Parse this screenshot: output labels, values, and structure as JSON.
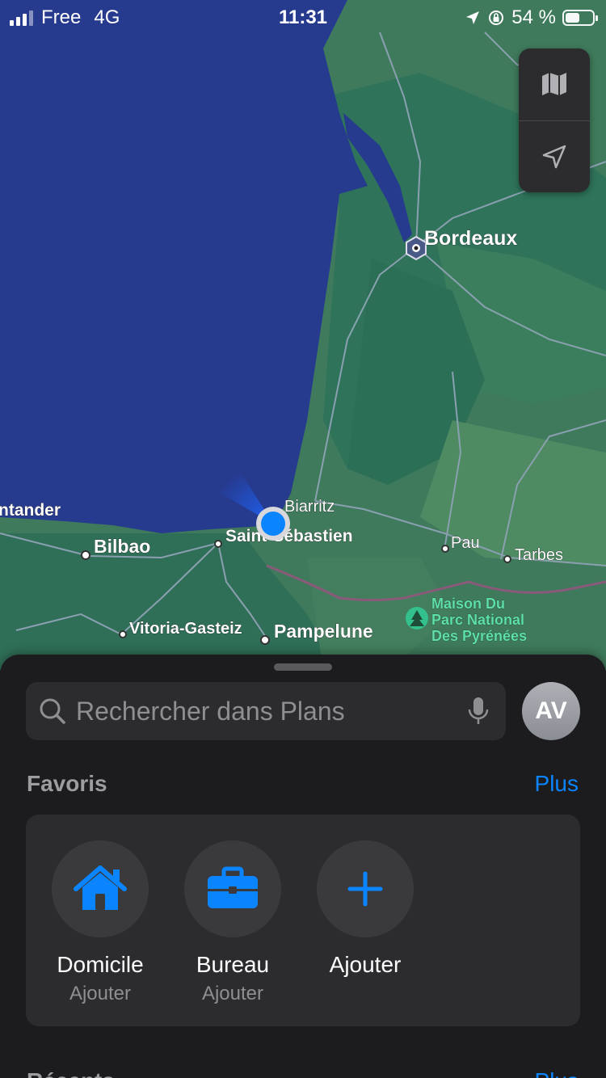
{
  "status_bar": {
    "carrier": "Free",
    "network": "4G",
    "time": "11:31",
    "battery_percent_label": "54 %",
    "battery_level": 0.54
  },
  "map": {
    "labels": {
      "bordeaux": "Bordeaux",
      "santander": "ntander",
      "bilbao": "Bilbao",
      "biarritz": "Biarritz",
      "saint_sebastien": "Saint-Sébastien",
      "pau": "Pau",
      "tarbes": "Tarbes",
      "vitoria": "Vitoria-Gasteiz",
      "pampelune": "Pampelune",
      "park_line1": "Maison Du",
      "park_line2": "Parc National",
      "park_line3": "Des Pyrénées"
    },
    "colors": {
      "ocean": "#263a8e",
      "land_forest": "#2f7a5f",
      "land_light": "#4e8a62",
      "roads": "#8aa0b0",
      "location": "#0a84ff"
    }
  },
  "map_controls": {
    "map_mode_icon": "map-icon",
    "locate_icon": "location-arrow-icon"
  },
  "search": {
    "placeholder": "Rechercher dans Plans"
  },
  "avatar": {
    "initials": "AV"
  },
  "favorites": {
    "title": "Favoris",
    "more": "Plus",
    "items": [
      {
        "title": "Domicile",
        "subtitle": "Ajouter",
        "icon": "house-icon"
      },
      {
        "title": "Bureau",
        "subtitle": "Ajouter",
        "icon": "briefcase-icon"
      },
      {
        "title": "Ajouter",
        "subtitle": "",
        "icon": "plus-icon"
      }
    ]
  },
  "next_section": {
    "title": "Récents",
    "more": "Plus"
  },
  "accent_color": "#0a84ff"
}
